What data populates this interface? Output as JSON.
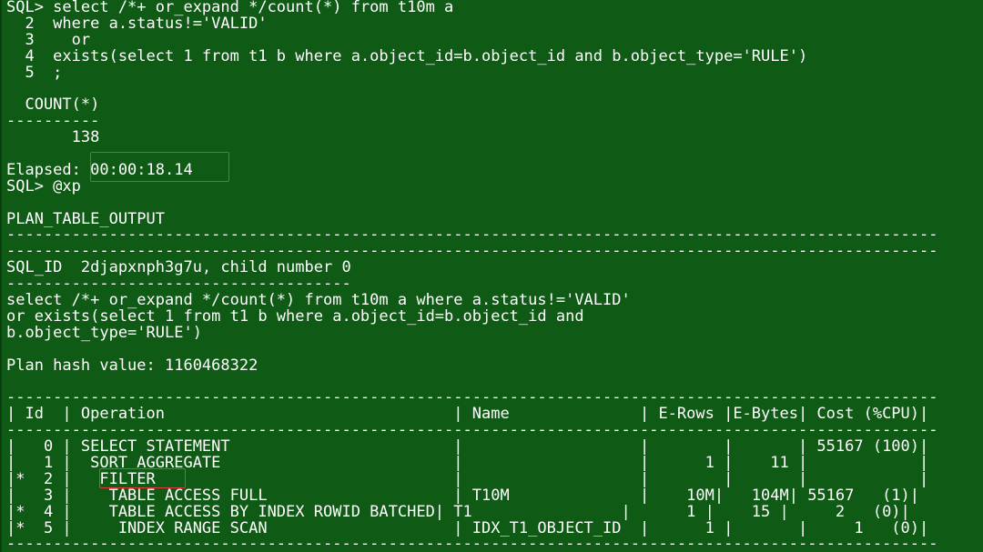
{
  "terminal": {
    "lines": [
      "SQL> select /*+ or_expand */count(*) from t10m a",
      "  2  where a.status!='VALID'",
      "  3    or",
      "  4  exists(select 1 from t1 b where a.object_id=b.object_id and b.object_type='RULE')",
      "  5  ;",
      "",
      "  COUNT(*)",
      "----------",
      "       138",
      "",
      "Elapsed: 00:00:18.14",
      "SQL> @xp",
      "",
      "PLAN_TABLE_OUTPUT",
      "----------------------------------------------------------------------------------------------------",
      "----------------------------------------------------------------------------------------------------",
      "SQL_ID  2djapxnph3g7u, child number 0",
      "-------------------------------------",
      "select /*+ or_expand */count(*) from t10m a where a.status!='VALID'",
      "or exists(select 1 from t1 b where a.object_id=b.object_id and",
      "b.object_type='RULE')",
      "",
      "Plan hash value: 1160468322",
      "",
      "----------------------------------------------------------------------------------------------------",
      "| Id  | Operation                               | Name              | E-Rows |E-Bytes| Cost (%CPU)|",
      "----------------------------------------------------------------------------------------------------",
      "|   0 | SELECT STATEMENT                        |                   |        |       | 55167 (100)|",
      "|   1 |  SORT AGGREGATE                         |                   |      1 |    11 |            |",
      "|*  2 |   FILTER                                |                   |        |       |            |",
      "|   3 |    TABLE ACCESS FULL                    | T10M              |    10M|   104M| 55167   (1)|",
      "|*  4 |    TABLE ACCESS BY INDEX ROWID BATCHED| T1                |      1 |    15 |     2   (0)|",
      "|*  5 |     INDEX RANGE SCAN                    | IDX_T1_OBJECT_ID  |      1 |       |     1   (0)|",
      "----------------------------------------------------------------------------------------------------"
    ]
  },
  "highlights": {
    "elapsed_value": "00:00:18.14",
    "filter_operation": "FILTER"
  },
  "colors": {
    "background": "#0f5a14",
    "text": "#ffffff",
    "highlight_box": "#e23b3b"
  }
}
